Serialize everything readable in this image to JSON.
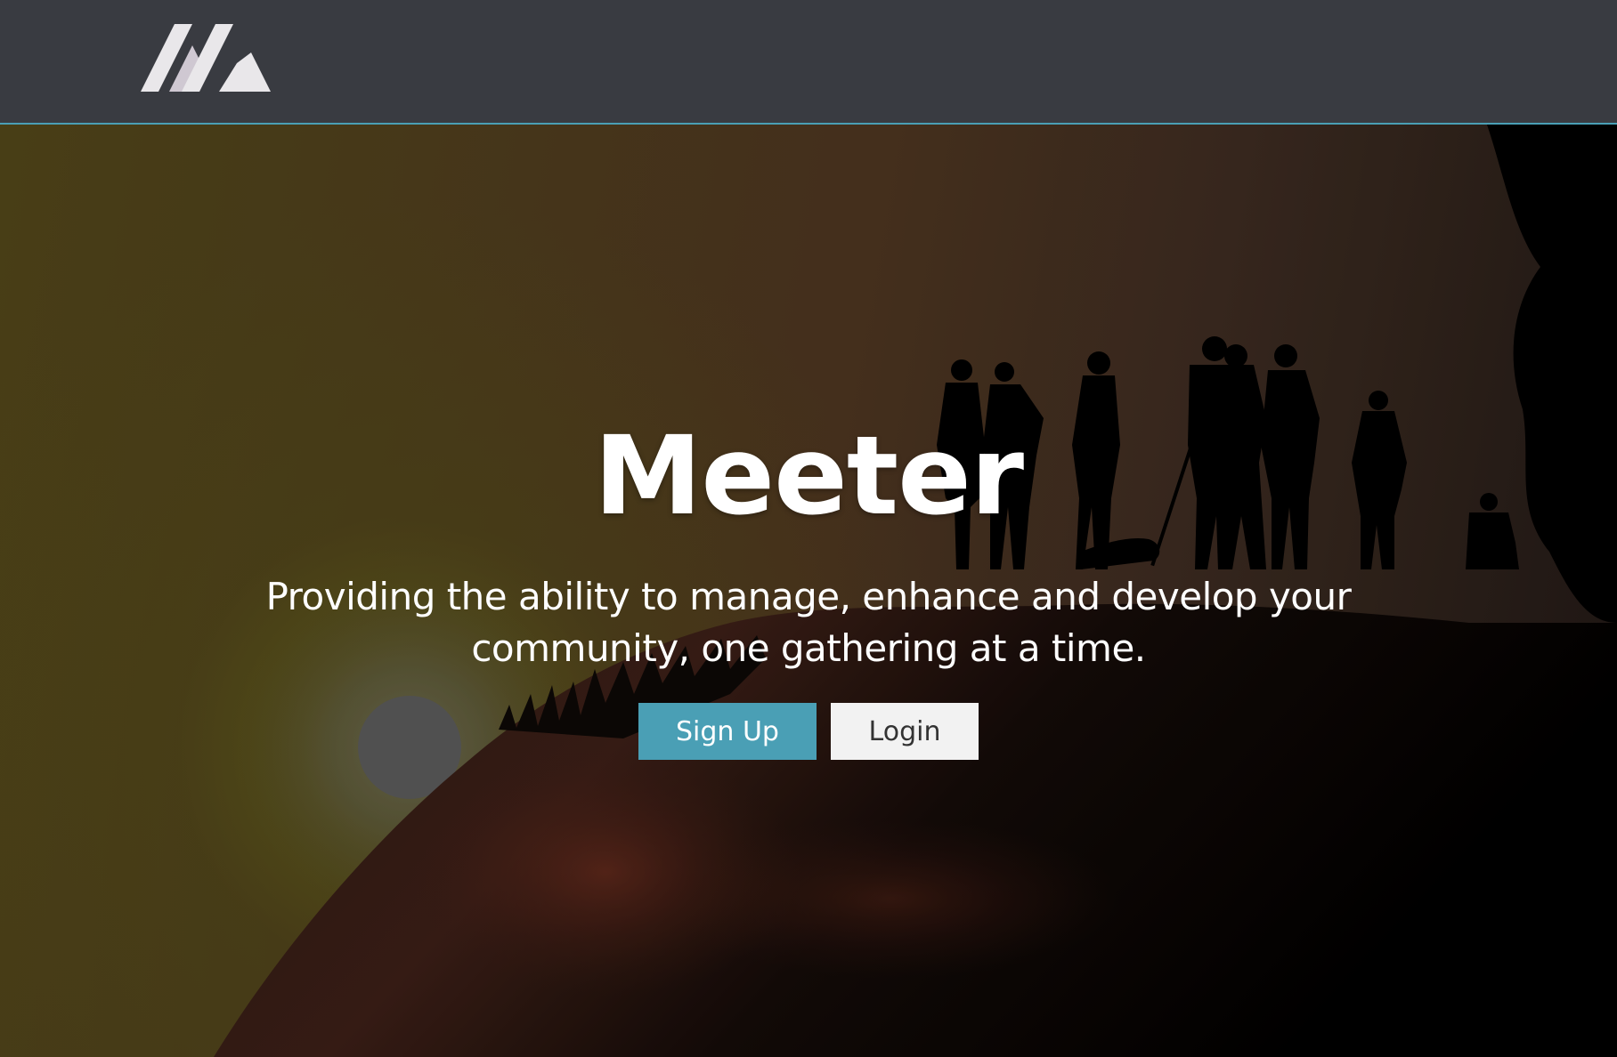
{
  "navbar": {
    "logo_icon": "meeter-logo-icon"
  },
  "hero": {
    "title": "Meeter",
    "tagline": "Providing the ability to manage, enhance and develop your community, one gathering at a time.",
    "background_image": "people-silhouettes-on-hill-at-sunset"
  },
  "buttons": {
    "signup_label": "Sign Up",
    "login_label": "Login"
  },
  "colors": {
    "navbar_bg": "#393b41",
    "accent": "#4a9fb5",
    "login_bg": "#f2f2f2"
  }
}
